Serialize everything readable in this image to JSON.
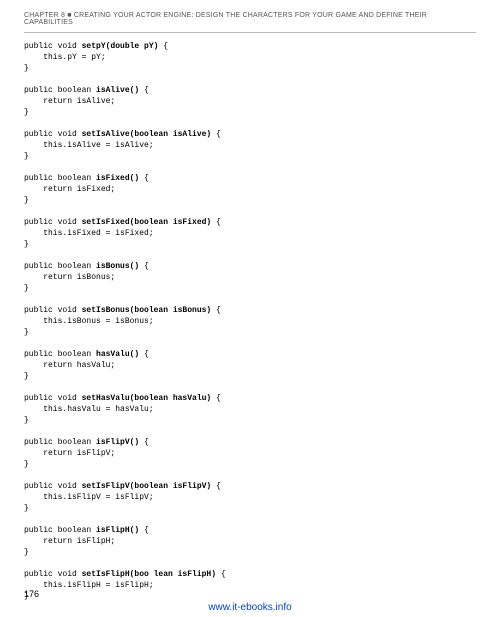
{
  "header": {
    "prefix": "CHAPTER 8 ",
    "square": "■",
    "title": " CREATING YOUR ACTOR ENGINE: DESIGN THE CHARACTERS FOR YOUR GAME AND DEFINE THEIR CAPABILITIES"
  },
  "code": {
    "m1": {
      "sig_pre": "public void ",
      "bold": "setpY(double pY)",
      "sig_post": " {",
      "body": "    this.pY = pY;",
      "close": "}"
    },
    "m2": {
      "sig_pre": "public boolean ",
      "bold": "isAlive()",
      "sig_post": " {",
      "body": "    return isAlive;",
      "close": "}"
    },
    "m3": {
      "sig_pre": "public void ",
      "bold": "setIsAlive(boolean isAlive)",
      "sig_post": " {",
      "body": "    this.isAlive = isAlive;",
      "close": "}"
    },
    "m4": {
      "sig_pre": "public boolean ",
      "bold": "isFixed()",
      "sig_post": " {",
      "body": "    return isFixed;",
      "close": "}"
    },
    "m5": {
      "sig_pre": "public void ",
      "bold": "setIsFixed(boolean isFixed)",
      "sig_post": " {",
      "body": "    this.isFixed = isFixed;",
      "close": "}"
    },
    "m6": {
      "sig_pre": "public boolean ",
      "bold": "isBonus()",
      "sig_post": " {",
      "body": "    return isBonus;",
      "close": "}"
    },
    "m7": {
      "sig_pre": "public void ",
      "bold": "setIsBonus(boolean isBonus)",
      "sig_post": " {",
      "body": "    this.isBonus = isBonus;",
      "close": "}"
    },
    "m8": {
      "sig_pre": "public boolean ",
      "bold": "hasValu()",
      "sig_post": " {",
      "body": "    return hasValu;",
      "close": "}"
    },
    "m9": {
      "sig_pre": "public void ",
      "bold": "setHasValu(boolean hasValu)",
      "sig_post": " {",
      "body": "    this.hasValu = hasValu;",
      "close": "}"
    },
    "m10": {
      "sig_pre": "public boolean ",
      "bold": "isFlipV()",
      "sig_post": " {",
      "body": "    return isFlipV;",
      "close": "}"
    },
    "m11": {
      "sig_pre": "public void ",
      "bold": "setIsFlipV(boolean isFlipV)",
      "sig_post": " {",
      "body": "    this.isFlipV = isFlipV;",
      "close": "}"
    },
    "m12": {
      "sig_pre": "public boolean ",
      "bold": "isFlipH()",
      "sig_post": " {",
      "body": "    return isFlipH;",
      "close": "}"
    },
    "m13": {
      "sig_pre": "public void ",
      "bold": "setIsFlipH(boo lean isFlipH)",
      "sig_post": " {",
      "body": "    this.isFlipH = isFlipH;",
      "close": "}"
    }
  },
  "page_number": "176",
  "footer_link": "www.it-ebooks.info"
}
